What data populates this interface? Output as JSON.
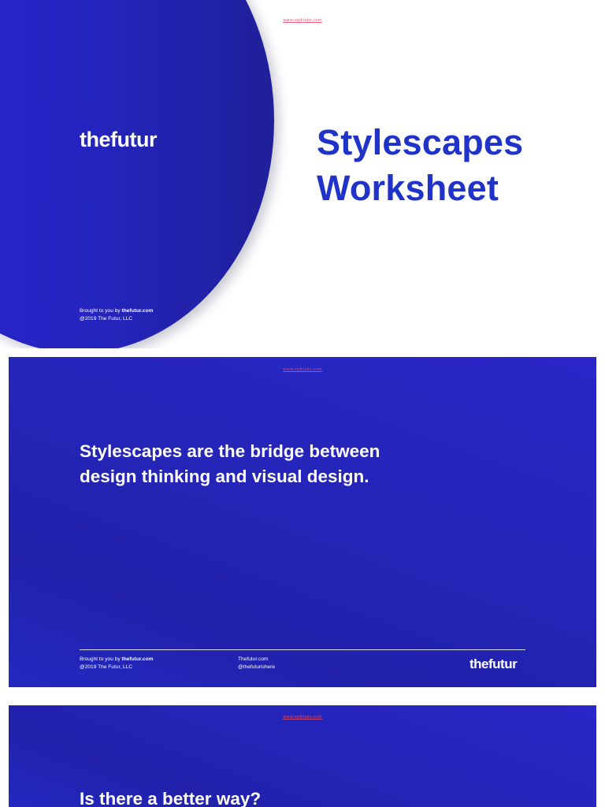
{
  "watermark": "www.sqiblabs.com",
  "cover": {
    "logo": "thefutur",
    "title_line1": "Stylescapes",
    "title_line2": "Worksheet",
    "credits_prefix": "Brought to you by ",
    "credits_link": "thefutur.com",
    "copyright": "@2019 The Futur, LLC"
  },
  "slide2": {
    "heading_line1": "Stylescapes are the bridge between",
    "heading_line2": "design thinking and visual design.",
    "credits_prefix": "Brought to you by ",
    "credits_link": "thefutur.com",
    "copyright": "@2019 The Futur, LLC",
    "site": "Thefutur.com",
    "handle": "@thefuturishere",
    "logo": "thefutur"
  },
  "slide3": {
    "heading": "Is there a better way?"
  },
  "colors": {
    "brand_blue": "#2525b8",
    "title_blue": "#1f33c8",
    "watermark_red": "#e0506a"
  }
}
